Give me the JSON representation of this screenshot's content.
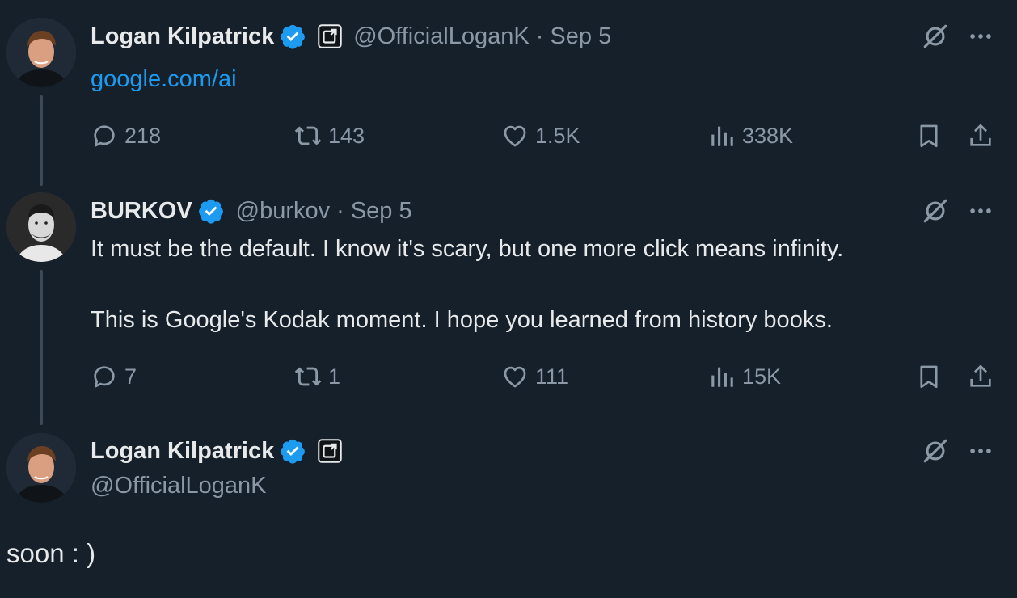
{
  "tweets": [
    {
      "name": "Logan Kilpatrick",
      "handle": "@OfficialLoganK",
      "dot": "·",
      "date": "Sep 5",
      "link": "google.com/ai",
      "stats": {
        "replies": "218",
        "reposts": "143",
        "likes": "1.5K",
        "views": "338K"
      }
    },
    {
      "name": "BURKOV",
      "handle": "@burkov",
      "dot": "·",
      "date": "Sep 5",
      "text_line1": "It must be the default. I know it's scary, but one more click means infinity.",
      "text_line2": "This is Google's Kodak moment. I hope you learned from history books.",
      "stats": {
        "replies": "7",
        "reposts": "1",
        "likes": "111",
        "views": "15K"
      }
    },
    {
      "name": "Logan Kilpatrick",
      "handle": "@OfficialLoganK",
      "text": "soon : )"
    }
  ],
  "icons": {
    "verified": "verified-badge-icon",
    "affiliation": "affiliation-badge-icon",
    "grok": "grok-icon",
    "more": "more-icon",
    "reply": "reply-icon",
    "repost": "repost-icon",
    "like": "heart-icon",
    "views": "views-icon",
    "bookmark": "bookmark-icon",
    "share": "share-icon"
  },
  "colors": {
    "background": "#15202b",
    "text": "#e7e9ea",
    "secondary": "#8b98a5",
    "link": "#1d9bf0",
    "verified": "#1d9bf0"
  }
}
